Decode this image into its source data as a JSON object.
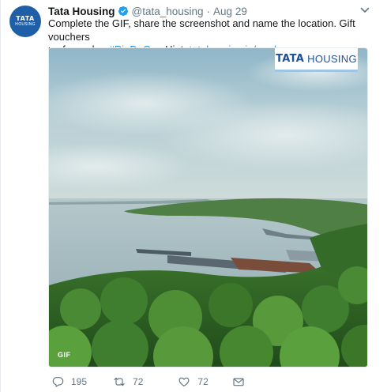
{
  "tweet": {
    "avatar": {
      "line1": "TATA",
      "line2": "HOUSING"
    },
    "author_name": "Tata Housing",
    "handle": "@tata_housing",
    "separator": "·",
    "date": "Aug 29",
    "text_line1": "Complete the GIF, share the screenshot and name the location. Gift vouchers",
    "text_line2_prefix": "up for grabs. ",
    "hashtag": "#RioDeGoa",
    "hint_label": " Hint: ",
    "link": "tatahousing.in/goa/"
  },
  "media": {
    "brand_bold": "TATA",
    "brand_rest": "HOUSING",
    "badge": "GIF"
  },
  "actions": {
    "reply_count": "195",
    "retweet_count": "72",
    "like_count": "72"
  },
  "colors": {
    "link": "#1b95e0",
    "verified": "#1da1f2",
    "brand_blue": "#1f5fa8",
    "muted": "#657786"
  },
  "icons": [
    "verified-badge-icon",
    "chevron-down-icon",
    "reply-icon",
    "retweet-icon",
    "heart-icon",
    "envelope-icon"
  ]
}
